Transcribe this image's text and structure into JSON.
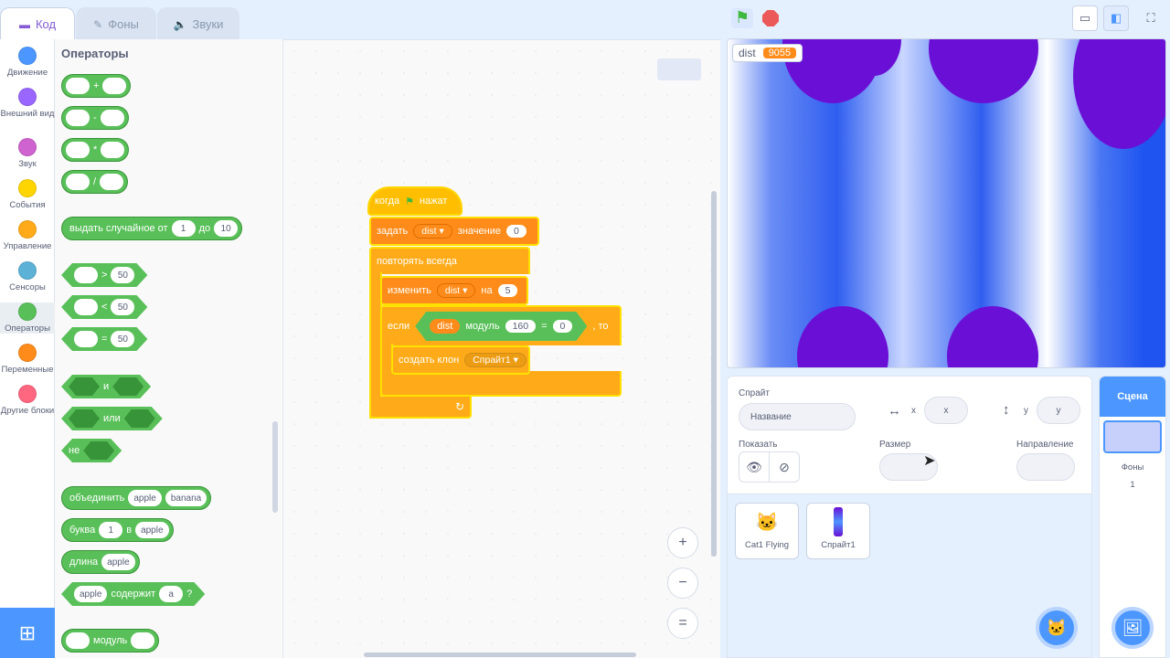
{
  "tabs": {
    "code": "Код",
    "backdrops": "Фоны",
    "sounds": "Звуки"
  },
  "categories": [
    {
      "label": "Движение",
      "color": "#4c97ff"
    },
    {
      "label": "Внешний вид",
      "color": "#9966ff"
    },
    {
      "label": "Звук",
      "color": "#cf63cf"
    },
    {
      "label": "События",
      "color": "#ffd500"
    },
    {
      "label": "Управление",
      "color": "#ffab19"
    },
    {
      "label": "Сенсоры",
      "color": "#5cb1d6"
    },
    {
      "label": "Операторы",
      "color": "#59c059"
    },
    {
      "label": "Переменные",
      "color": "#ff8c1a"
    },
    {
      "label": "Другие блоки",
      "color": "#ff6680"
    }
  ],
  "palette": {
    "title": "Операторы",
    "add": "+",
    "sub": "-",
    "mul": "*",
    "div": "/",
    "random": {
      "label": "выдать случайное от",
      "from": "1",
      "to_label": "до",
      "to": "10"
    },
    "gt": {
      "op": ">",
      "value": "50"
    },
    "lt": {
      "op": "<",
      "value": "50"
    },
    "eq": {
      "op": "=",
      "value": "50"
    },
    "and": "и",
    "or": "или",
    "not": "не",
    "join": {
      "label": "объединить",
      "a": "apple",
      "b": "banana"
    },
    "letter": {
      "label": "буква",
      "n": "1",
      "in_label": "в",
      "s": "apple"
    },
    "length": {
      "label": "длина",
      "s": "apple"
    },
    "contains": {
      "s": "apple",
      "label": "содержит",
      "c": "a",
      "q": "?"
    },
    "mod": "модуль"
  },
  "script": {
    "hat": {
      "label1": "когда",
      "label2": "нажат"
    },
    "set": {
      "label": "задать",
      "var": "dist",
      "label2": "значение",
      "value": "0"
    },
    "forever": "повторять всегда",
    "change": {
      "label": "изменить",
      "var": "dist",
      "label2": "на",
      "value": "5"
    },
    "if": {
      "label": "если",
      "var": "dist",
      "op": "модуль",
      "n": "160",
      "eq": "=",
      "v": "0",
      "then": ", то"
    },
    "clone": {
      "label": "создать клон",
      "target": "Спрайт1"
    }
  },
  "zoom": {
    "in": "+",
    "out": "−",
    "reset": "="
  },
  "stage": {
    "monitor_label": "dist",
    "monitor_value": "9055"
  },
  "sprite_info": {
    "sprite_label": "Спрайт",
    "name_placeholder": "Название",
    "x_label": "x",
    "x_placeholder": "x",
    "y_label": "y",
    "y_placeholder": "y",
    "show_label": "Показать",
    "size_label": "Размер",
    "direction_label": "Направление"
  },
  "sprites": [
    {
      "name": "Cat1 Flying"
    },
    {
      "name": "Спрайт1"
    }
  ],
  "stage_panel": {
    "title": "Сцена",
    "backdrops_label": "Фоны",
    "backdrops_count": "1"
  }
}
